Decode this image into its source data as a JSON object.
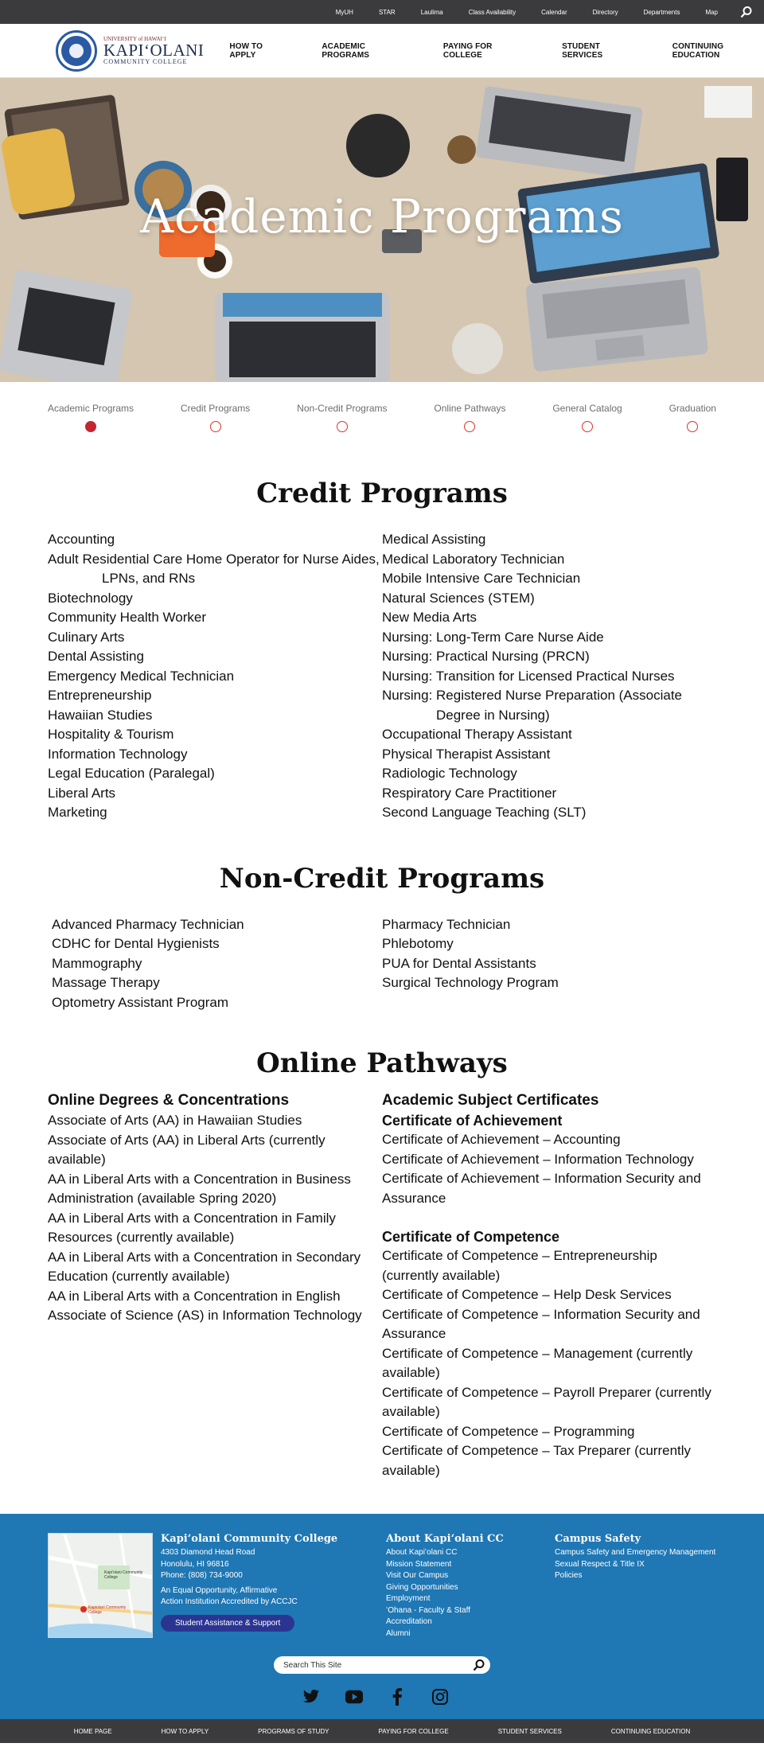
{
  "topbar": {
    "links": [
      "MyUH",
      "STAR",
      "Laulima",
      "Class Availability",
      "Calendar",
      "Directory",
      "Departments",
      "Map"
    ]
  },
  "logo": {
    "university": "UNIVERSITY of HAWAIʻI",
    "name": "KAPIʻOLANI",
    "subtitle": "COMMUNITY COLLEGE"
  },
  "mainnav": [
    "HOW TO APPLY",
    "ACADEMIC PROGRAMS",
    "PAYING FOR COLLEGE",
    "STUDENT SERVICES",
    "CONTINUING EDUCATION"
  ],
  "hero": {
    "title": "Academic Programs"
  },
  "secnav": [
    {
      "label": "Academic Programs",
      "active": true
    },
    {
      "label": "Credit Programs",
      "active": false
    },
    {
      "label": "Non-Credit Programs",
      "active": false
    },
    {
      "label": "Online Pathways",
      "active": false
    },
    {
      "label": "General Catalog",
      "active": false
    },
    {
      "label": "Graduation",
      "active": false
    }
  ],
  "credit": {
    "title": "Credit Programs",
    "left": [
      "Accounting",
      "Adult Residential Care Home Operator for Nurse Aides, LPNs, and RNs",
      "Biotechnology",
      "Community Health Worker",
      "Culinary Arts",
      "Dental Assisting",
      "Emergency Medical Technician",
      "Entrepreneurship",
      "Hawaiian Studies",
      "Hospitality & Tourism",
      "Information Technology",
      "Legal Education (Paralegal)",
      "Liberal Arts",
      "Marketing"
    ],
    "right": [
      "Medical Assisting",
      "Medical Laboratory Technician",
      "Mobile Intensive Care Technician",
      "Natural Sciences (STEM)",
      "New Media Arts",
      "Nursing: Long-Term Care Nurse Aide",
      "Nursing: Practical Nursing (PRCN)",
      "Nursing: Transition for Licensed Practical Nurses",
      "Nursing: Registered Nurse Preparation (Associate Degree in Nursing)",
      "Occupational Therapy Assistant",
      "Physical Therapist Assistant",
      "Radiologic Technology",
      "Respiratory Care Practitioner",
      "Second Language Teaching (SLT)"
    ]
  },
  "noncredit": {
    "title": "Non-Credit Programs",
    "left": [
      "Advanced Pharmacy Technician",
      "CDHC for Dental Hygienists",
      "Mammography",
      "Massage Therapy",
      "Optometry Assistant Program"
    ],
    "right": [
      "Pharmacy Technician",
      "Phlebotomy",
      "PUA for Dental Assistants",
      "Surgical Technology Program"
    ]
  },
  "online": {
    "title": "Online Pathways",
    "left_heading": "Online Degrees & Concentrations",
    "left": [
      "Associate of Arts (AA) in Hawaiian Studies",
      "Associate of Arts (AA) in Liberal Arts (currently available)",
      "AA in Liberal Arts with a Concentration in Business Administration (available Spring 2020)",
      "AA in Liberal Arts with a Concentration in Family Resources (currently available)",
      "AA in Liberal Arts with a Concentration in Secondary Education (currently available)",
      "AA in Liberal Arts with a Concentration in English",
      "Associate of Science (AS) in Information Technology"
    ],
    "right_heading": "Academic Subject Certificates",
    "achievement_heading": "Certificate of Achievement",
    "achievement": [
      "Certificate of Achievement – Accounting",
      "Certificate of Achievement – Information Technology",
      "Certificate of Achievement – Information Security and Assurance"
    ],
    "competence_heading": "Certificate of Competence",
    "competence": [
      "Certificate of Competence – Entrepreneurship (currently available)",
      "Certificate of Competence – Help Desk Services",
      "Certificate of Competence – Information Security and Assurance",
      "Certificate of Competence – Management (currently available)",
      "Certificate of Competence – Payroll Preparer (currently available)",
      "Certificate of Competence – Programming",
      "Certificate of Competence – Tax Preparer (currently available)"
    ]
  },
  "footer": {
    "college": {
      "title": "Kapiʻolani Community College",
      "address1": "4303 Diamond Head Road",
      "address2": "Honolulu, HI 96816",
      "phone": "Phone: (808) 734-9000",
      "eeo1": "An Equal Opportunity, Affirmative",
      "eeo2": "Action Institution Accredited by ACCJC",
      "button": "Student Assistance & Support"
    },
    "about": {
      "title": "About Kapiʻolani CC",
      "links": [
        "About Kapiʻolani CC",
        "Mission Statement",
        "Visit Our Campus",
        "Giving Opportunities",
        "Employment",
        "ʻOhana - Faculty & Staff",
        "Accreditation",
        "Alumni"
      ]
    },
    "safety": {
      "title": "Campus Safety",
      "links": [
        "Campus Safety and Emergency Management",
        "Sexual Respect & Title IX",
        "Policies"
      ]
    },
    "search_placeholder": "Search This Site",
    "map": {
      "label1": "Kapiʻolani Community College",
      "label2": "Kapiolani Community College"
    }
  },
  "bottombar": [
    "HOME PAGE",
    "HOW TO APPLY",
    "PROGRAMS OF STUDY",
    "PAYING FOR COLLEGE",
    "STUDENT SERVICES",
    "CONTINUING EDUCATION"
  ],
  "colors": {
    "accent_red": "#c42630",
    "footer_blue": "#1f77b4",
    "bar_gray": "#3b3b3e",
    "button_navy": "#2a3592"
  }
}
